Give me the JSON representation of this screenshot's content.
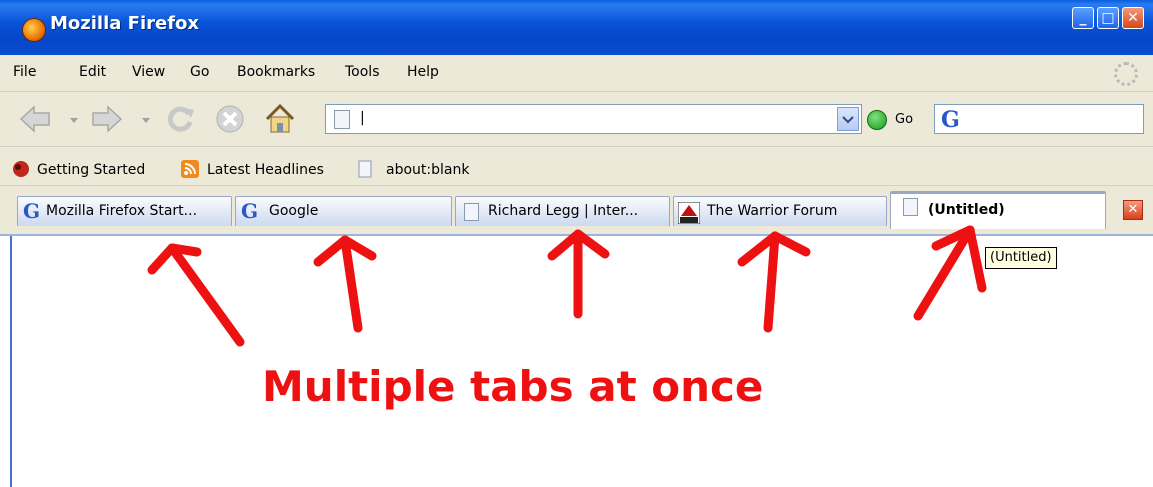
{
  "window": {
    "title": "Mozilla Firefox"
  },
  "menu": [
    "File",
    "Edit",
    "View",
    "Go",
    "Bookmarks",
    "Tools",
    "Help"
  ],
  "navbar": {
    "url_value": "|",
    "go_label": "Go"
  },
  "bookmarks": [
    {
      "label": "Getting Started",
      "icon": "firefox-bookmark-icon"
    },
    {
      "label": "Latest Headlines",
      "icon": "rss-feed-icon"
    },
    {
      "label": "about:blank",
      "icon": "page-icon"
    }
  ],
  "tabs": [
    {
      "label": "Mozilla Firefox Start...",
      "icon": "google-g-icon",
      "active": false
    },
    {
      "label": "Google",
      "icon": "google-g-icon",
      "active": false
    },
    {
      "label": "Richard Legg | Inter...",
      "icon": "page-icon",
      "active": false
    },
    {
      "label": "The Warrior Forum",
      "icon": "warrior-forum-icon",
      "active": false
    },
    {
      "label": "(Untitled)",
      "icon": "page-icon",
      "active": true
    }
  ],
  "tooltip": "(Untitled)",
  "annotation": "Multiple tabs at once",
  "colors": {
    "titlebar": "#0a55d8",
    "annotation": "#ee1111",
    "active_tab_accent": "#f0a830"
  }
}
